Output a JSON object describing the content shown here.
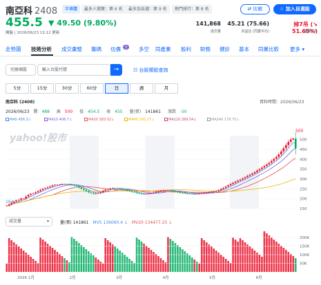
{
  "header": {
    "name": "南亞科",
    "code": "2408",
    "tags": [
      "半導體",
      "最多人瀏覽：第 6 名",
      "最多加自選：第 9 名",
      "熱門排行：第 8 名"
    ],
    "compare": "比較",
    "add": "加入自選股",
    "price": "455.5",
    "change": "▼ 49.50 (9.80%)",
    "time": "開盤 | 2026/06/23 13:12 更新",
    "stats": [
      {
        "value": "141,868",
        "label": "成交量"
      },
      {
        "value": "45.21 (75.66)",
        "label": "本益比 (同業平均)"
      },
      {
        "value": "掉7吊 (↘ 51.65%)",
        "label": "漲跌帳戶"
      }
    ]
  },
  "tabs": [
    "走勢圖",
    "技術分析",
    "成交彙整",
    "籌碼",
    "估價",
    "分",
    "多空",
    "同產業",
    "股利",
    "財務",
    "健診",
    "基本",
    "同業比較",
    "更多"
  ],
  "filters": {
    "category": "切換個股",
    "search_placeholder": "輸入台股代號",
    "link": "台股類股查詢"
  },
  "periods": [
    "5分",
    "15分",
    "30分",
    "60分",
    "日",
    "週",
    "月"
  ],
  "info": {
    "title": "南亞科 (2408)",
    "date": "2026/06/23",
    "updated": "資料時間：2026/06/23",
    "open_lbl": "開",
    "open": "488",
    "high_lbl": "高",
    "high": "500",
    "low_lbl": "低",
    "low": "454.5",
    "close_lbl": "收",
    "close": "455",
    "vol_lbl": "量(張)",
    "vol": "141861",
    "chg_lbl": "漲跌",
    "chg": "-50"
  },
  "ma": [
    {
      "label": "MA5 456.3↓",
      "color": "#3c8ae0"
    },
    {
      "label": "MA10 408.7↓",
      "color": "#7b5ed6"
    },
    {
      "label": "MA20 383.52↓",
      "color": "#e0504a"
    },
    {
      "label": "MA60 292.27↓",
      "color": "#f0b400"
    },
    {
      "label": "MA120 269.54↓",
      "color": "#c0447a"
    },
    {
      "label": "MA240 178.75↓",
      "color": "#8c95a0"
    }
  ],
  "volume": {
    "select": "成交量",
    "vol": "量(張) 141861",
    "mv5": "MV5 136060.4 ↓",
    "mv20": "MV20 134477.25 ↓"
  },
  "chart_data": {
    "type": "candlestick",
    "series": [
      {
        "name": "price",
        "values": [
          164.5,
          171.0,
          178.3,
          185.3,
          190.6,
          194.5,
          201.2,
          201.2,
          210.9,
          219.1,
          224.5,
          227.8,
          233.0,
          238.3,
          245.0,
          250.7,
          254.1,
          258.3,
          262.5,
          267.6,
          270.7,
          270.9,
          272.0,
          274.4,
          273.6,
          274.0,
          271.7,
          268.9,
          265.9,
          262.9,
          256.8,
          250.6,
          244.9,
          239.4,
          232.9,
          229.1,
          224.9,
          227.6,
          230.0,
          234.1,
          240.3,
          245.7,
          248.5,
          252.2,
          254.2,
          253.8,
          252.1,
          250.7,
          248.0,
          245.7,
          241.8,
          238.7,
          234.8,
          231.9,
          228.4,
          225.8,
          223.9,
          224.2,
          224.7,
          227.6,
          229.0,
          231.9,
          235.0,
          238.4,
          241.0,
          242.9,
          243.0,
          243.1,
          241.9,
          239.1,
          236.2,
          233.0,
          229.8,
          227.9,
          227.6,
          226.3,
          224.9,
          224.0,
          224.3,
          224.2,
          226.6,
          229.3,
          230.7,
          231.6,
          234.1,
          236.2,
          238.1,
          240.5,
          243.9,
          249.8,
          255.2,
          261.8,
          268.5,
          274.6,
          280.6,
          286.5,
          292.0,
          297.0,
          303.0,
          309.0,
          316.0,
          322.0,
          328.0,
          335.0,
          343.0,
          350.0,
          358.0,
          366.0,
          374.0,
          382.0,
          392.0,
          402.0,
          412.0,
          425.0,
          440.0,
          456.0,
          472.0,
          488.0,
          500.0,
          505.0,
          455.5
        ]
      }
    ],
    "xlabels": [
      "2026 1月",
      "2月",
      "3月",
      "4月",
      "5月",
      "6月"
    ],
    "yticks": [
      150,
      200,
      250,
      300,
      350,
      400,
      450,
      500
    ],
    "vticks": [
      "200K",
      "150K",
      "100K",
      "50K"
    ],
    "max_label": "505",
    "min_label": "164.5"
  }
}
